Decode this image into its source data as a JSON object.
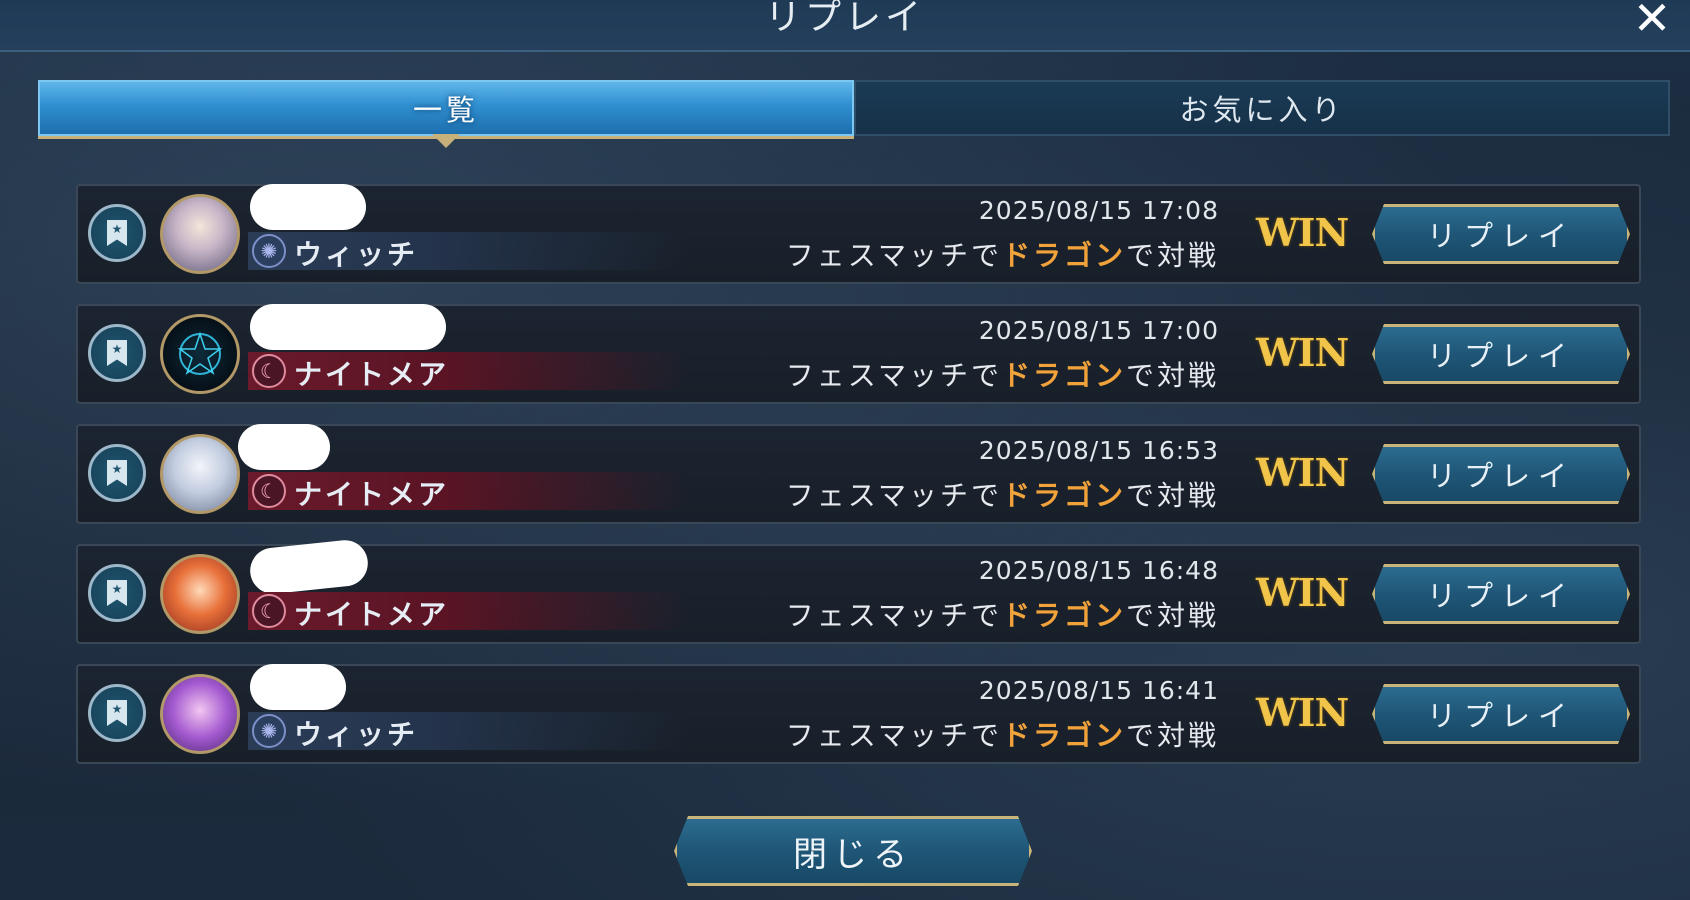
{
  "header": {
    "title": "リプレイ",
    "close_icon": "close-icon"
  },
  "tabs": [
    {
      "label": "一覧",
      "active": true
    },
    {
      "label": "お気に入り",
      "active": false
    }
  ],
  "colors": {
    "accent_gold": "#c9b47a",
    "win_gold": "#f1c54a",
    "opponent_orange": "#f2a23a",
    "active_tab_blue": "#2f8fd0",
    "witch_band": "#2b3c57",
    "nightmare_band": "#6a1a2a"
  },
  "replays": [
    {
      "class": "ウィッチ",
      "class_icon": "witch-icon",
      "class_type": "witch",
      "datetime": "2025/08/15 17:08",
      "mode": "フェスマッチで",
      "opponent": "ドラゴン",
      "suffix": "で対戦",
      "result": "WIN",
      "button": "リプレイ"
    },
    {
      "class": "ナイトメア",
      "class_icon": "nightmare-icon",
      "class_type": "nightmare",
      "datetime": "2025/08/15 17:00",
      "mode": "フェスマッチで",
      "opponent": "ドラゴン",
      "suffix": "で対戦",
      "result": "WIN",
      "button": "リプレイ"
    },
    {
      "class": "ナイトメア",
      "class_icon": "nightmare-icon",
      "class_type": "nightmare",
      "datetime": "2025/08/15 16:53",
      "mode": "フェスマッチで",
      "opponent": "ドラゴン",
      "suffix": "で対戦",
      "result": "WIN",
      "button": "リプレイ"
    },
    {
      "class": "ナイトメア",
      "class_icon": "nightmare-icon",
      "class_type": "nightmare",
      "datetime": "2025/08/15 16:48",
      "mode": "フェスマッチで",
      "opponent": "ドラゴン",
      "suffix": "で対戦",
      "result": "WIN",
      "button": "リプレイ"
    },
    {
      "class": "ウィッチ",
      "class_icon": "witch-icon",
      "class_type": "witch",
      "datetime": "2025/08/15 16:41",
      "mode": "フェスマッチで",
      "opponent": "ドラゴン",
      "suffix": "で対戦",
      "result": "WIN",
      "button": "リプレイ"
    }
  ],
  "footer": {
    "close_label": "閉じる"
  }
}
